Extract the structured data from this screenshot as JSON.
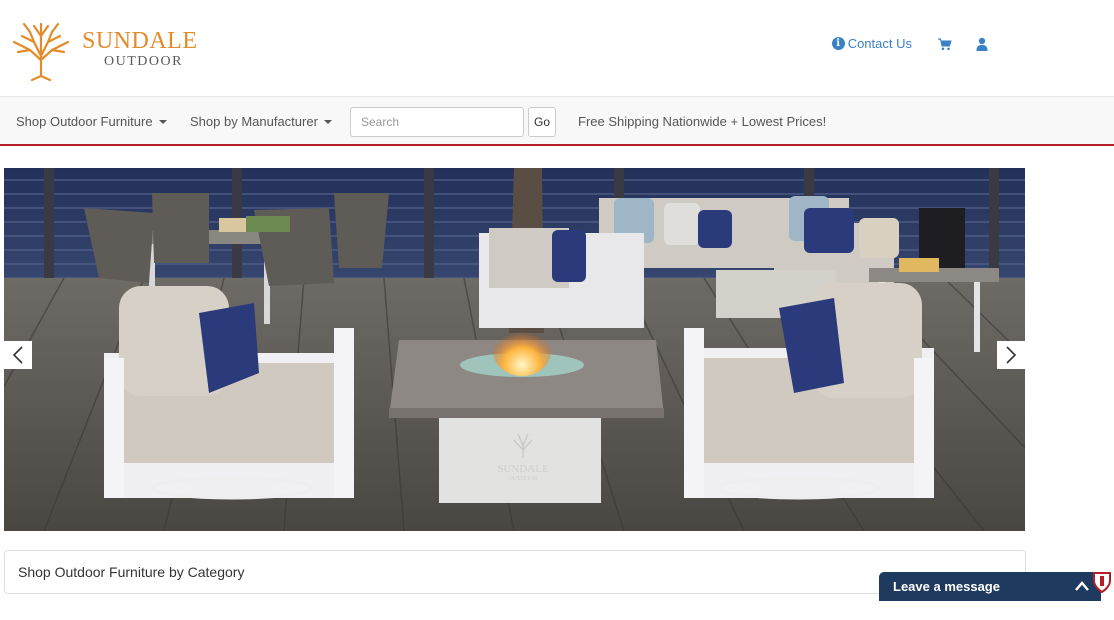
{
  "brand": {
    "name": "SUNDALE",
    "sub": "OUTDOOR",
    "color": "#e48b2a"
  },
  "header": {
    "contact_label": "Contact Us",
    "link_color": "#3a82c8",
    "icons": [
      "info-icon",
      "cart-icon",
      "user-icon"
    ]
  },
  "nav": {
    "items": [
      {
        "label": "Shop Outdoor Furniture"
      },
      {
        "label": "Shop by Manufacturer"
      }
    ],
    "search": {
      "placeholder": "Search",
      "value": ""
    },
    "go_label": "Go",
    "promo": "Free Shipping Nationwide + Lowest Prices!",
    "accent": "#b41f25"
  },
  "hero": {
    "logo_text": "SUNDALE",
    "logo_sub": "OUTDOOR",
    "controls": [
      "chevron-left-icon",
      "chevron-right-icon"
    ]
  },
  "category": {
    "title": "Shop Outdoor Furniture by Category"
  },
  "chat": {
    "label": "Leave a message",
    "color": "#1e3a5f"
  }
}
